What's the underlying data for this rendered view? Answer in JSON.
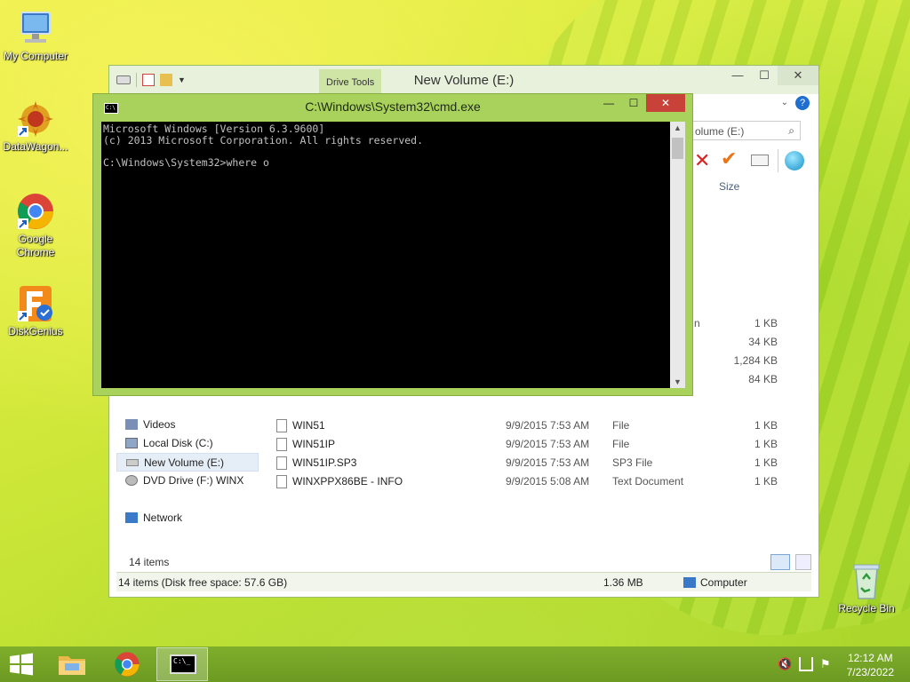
{
  "desktop": {
    "icons": [
      {
        "label": "My Computer"
      },
      {
        "label": "DataWagon..."
      },
      {
        "label": "Google Chrome"
      },
      {
        "label": "DiskGenius"
      },
      {
        "label": "Recycle Bin"
      }
    ]
  },
  "explorer": {
    "title": "New Volume (E:)",
    "context_tab": "Drive Tools",
    "search_placeholder": "olume (E:)",
    "column_size": "Size",
    "partial_type_text": "n",
    "right_sizes": [
      "1 KB",
      "34 KB",
      "1,284 KB",
      "84 KB"
    ],
    "nav": [
      {
        "label": "Videos"
      },
      {
        "label": "Local Disk (C:)"
      },
      {
        "label": "New Volume (E:)",
        "selected": true
      },
      {
        "label": "DVD Drive (F:) WINX"
      },
      {
        "label": "Network"
      }
    ],
    "files": [
      {
        "name": "WIN51",
        "date": "9/9/2015 7:53 AM",
        "type": "File",
        "size": "1 KB"
      },
      {
        "name": "WIN51IP",
        "date": "9/9/2015 7:53 AM",
        "type": "File",
        "size": "1 KB"
      },
      {
        "name": "WIN51IP.SP3",
        "date": "9/9/2015 7:53 AM",
        "type": "SP3 File",
        "size": "1 KB"
      },
      {
        "name": "WINXPPX86BE - INFO",
        "date": "9/9/2015 5:08 AM",
        "type": "Text Document",
        "size": "1 KB"
      }
    ],
    "items_count": "14 items",
    "status_left": "14 items (Disk free space: 57.6 GB)",
    "status_size": "1.36 MB",
    "status_location": "Computer"
  },
  "cmd": {
    "title": "C:\\Windows\\System32\\cmd.exe",
    "lines": [
      "Microsoft Windows [Version 6.3.9600]",
      "(c) 2013 Microsoft Corporation. All rights reserved.",
      "",
      "C:\\Windows\\System32>where o"
    ]
  },
  "taskbar": {
    "time": "12:12 AM",
    "date": "7/23/2022"
  }
}
